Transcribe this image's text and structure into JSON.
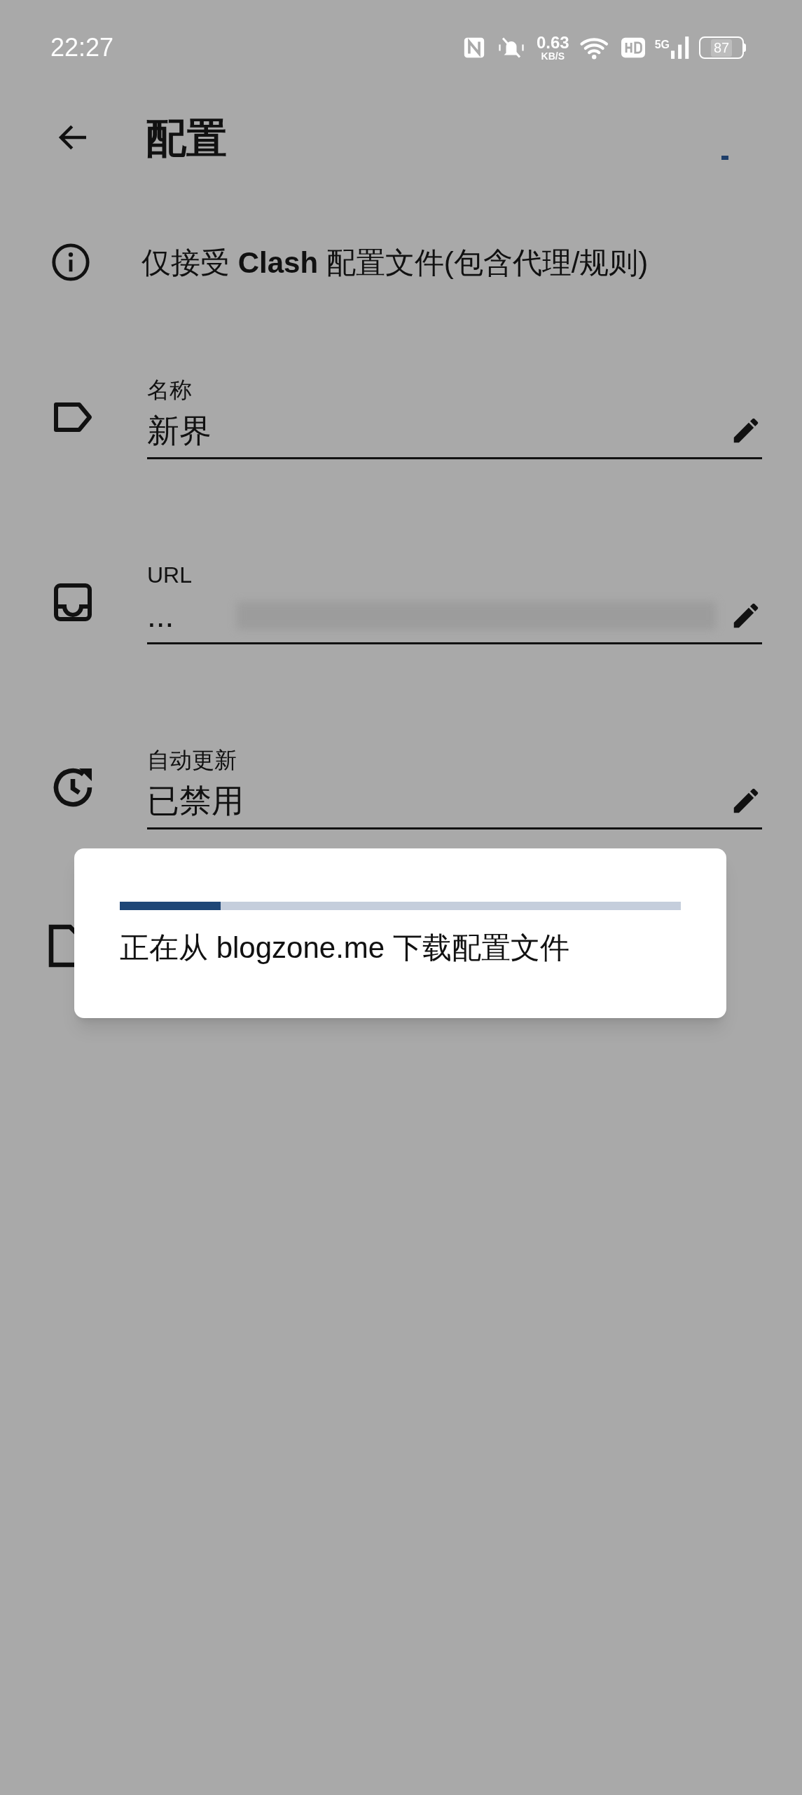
{
  "status_bar": {
    "time": "22:27",
    "net_speed": "0.63",
    "net_unit": "KB/S",
    "network": "5G",
    "battery": "87"
  },
  "app_bar": {
    "title": "配置"
  },
  "info": {
    "text": "仅接受 **Clash** 配置文件(包含代理/规则)"
  },
  "fields": [
    {
      "kind": "tag",
      "label": "名称",
      "value": "新界"
    },
    {
      "kind": "inbox",
      "label": "URL",
      "value": "...",
      "redacted": true
    },
    {
      "kind": "update",
      "label": "自动更新",
      "value": "已禁用"
    }
  ],
  "dialog": {
    "level": 0.18,
    "message": "正在从 blogzone.me 下载配置文件"
  }
}
